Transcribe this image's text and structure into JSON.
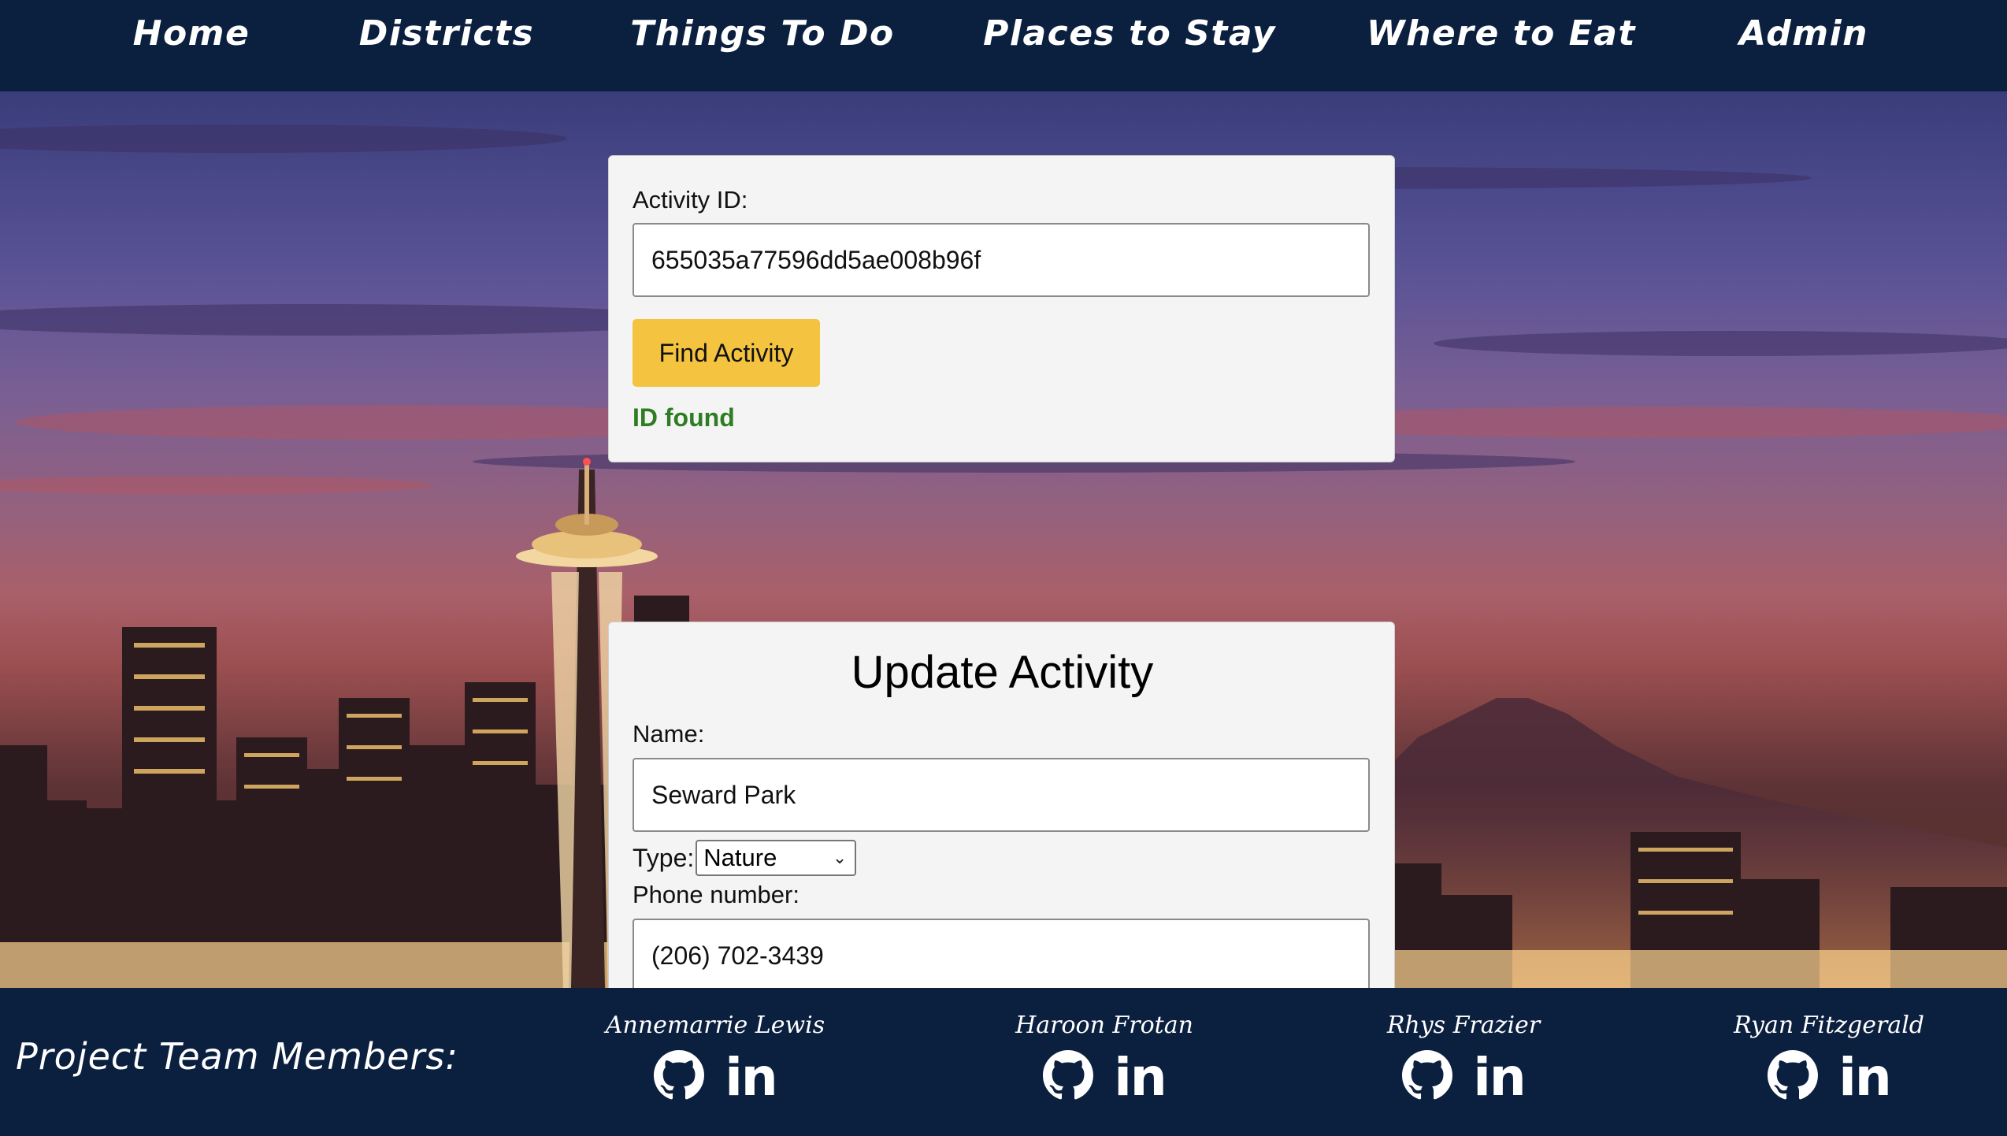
{
  "nav": {
    "items": [
      {
        "label": "Home"
      },
      {
        "label": "Districts"
      },
      {
        "label": "Things To Do"
      },
      {
        "label": "Places to Stay"
      },
      {
        "label": "Where to Eat"
      },
      {
        "label": "Admin"
      }
    ]
  },
  "find": {
    "id_label": "Activity ID:",
    "id_value": "655035a77596dd5ae008b96f",
    "button_label": "Find Activity",
    "status": "ID found"
  },
  "update": {
    "title": "Update Activity",
    "name_label": "Name:",
    "name_value": "Seward Park",
    "type_label": "Type:",
    "type_value": "Nature",
    "phone_label": "Phone number:",
    "phone_value": "(206) 702-3439"
  },
  "footer": {
    "title": "Project Team Members:",
    "members": [
      {
        "name": "Annemarrie Lewis"
      },
      {
        "name": "Haroon Frotan"
      },
      {
        "name": "Rhys Frazier"
      },
      {
        "name": "Ryan Fitzgerald"
      }
    ],
    "icons": [
      "github-icon",
      "linkedin-icon"
    ],
    "linkedin_glyph": "in"
  },
  "colors": {
    "nav_bg": "#0b1f3f",
    "button": "#f4c440",
    "status_ok": "#2e7d23",
    "card_bg": "#f4f4f4"
  }
}
